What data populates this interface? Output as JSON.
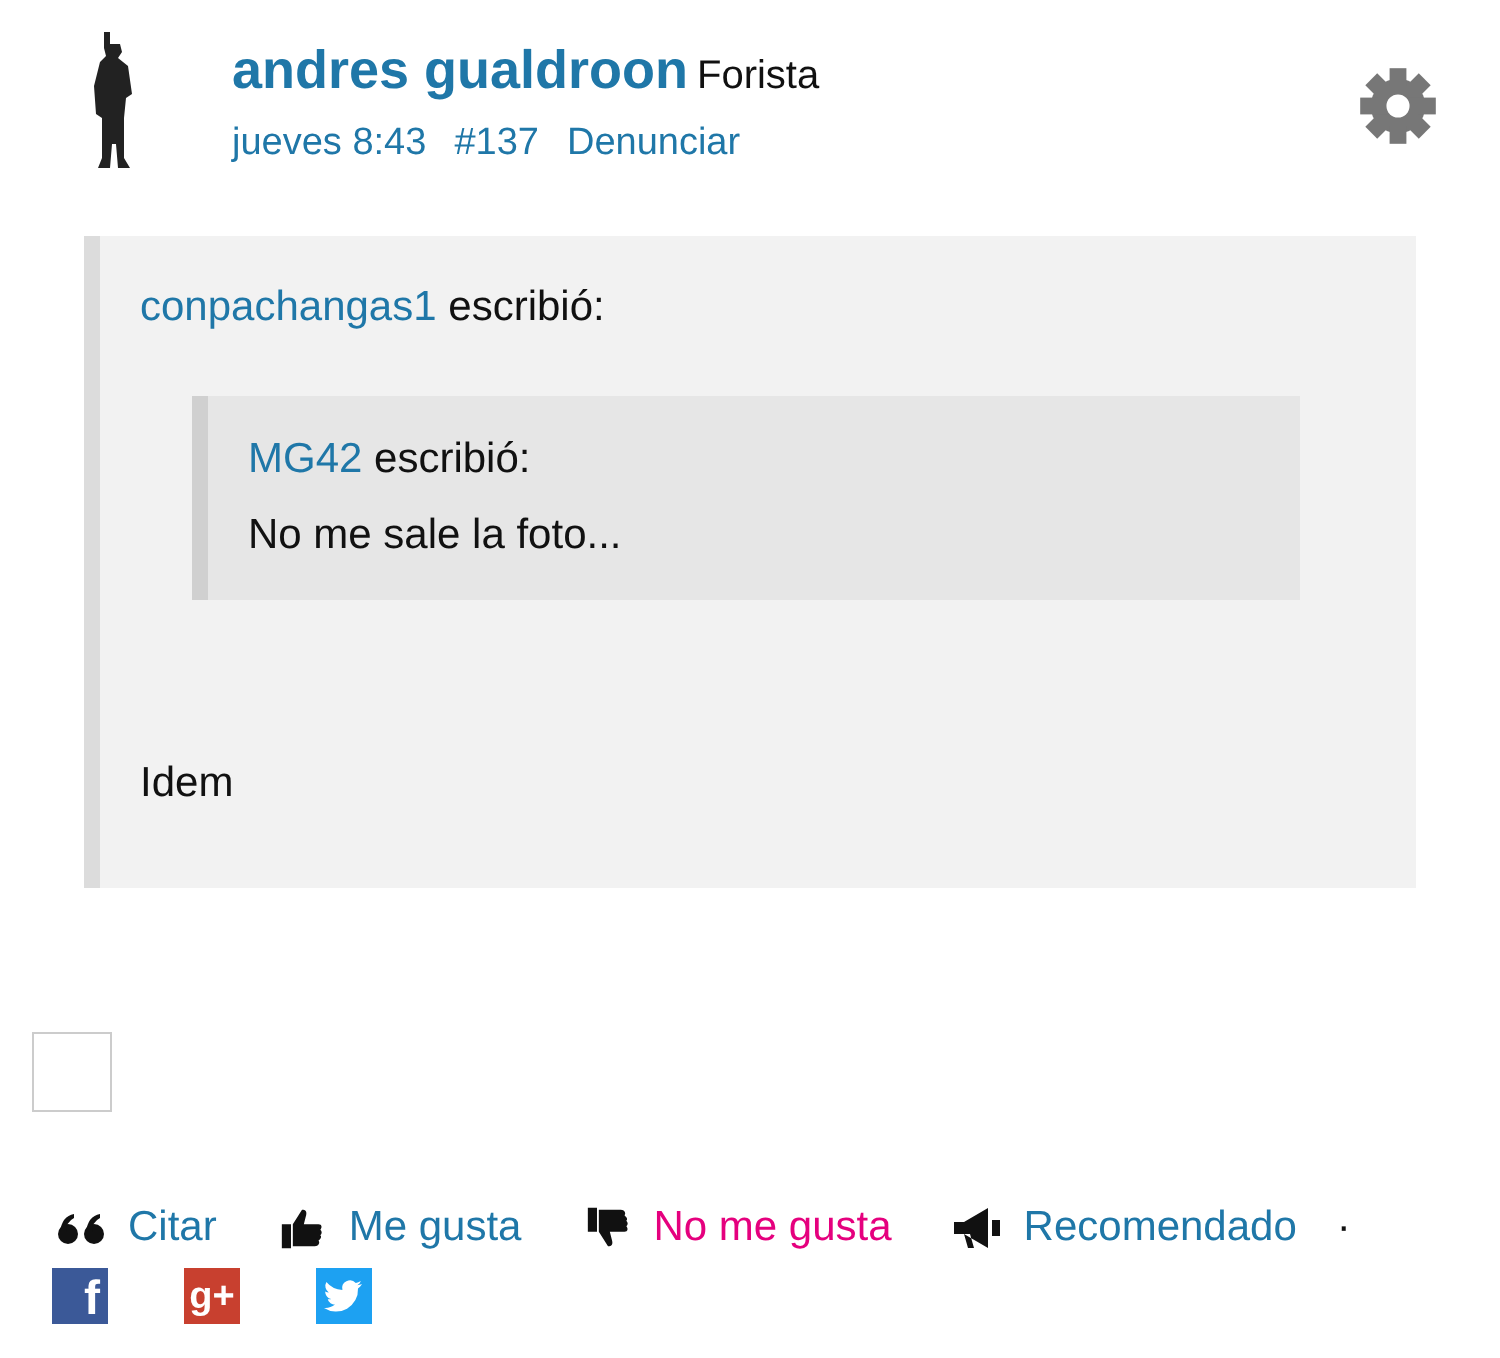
{
  "post": {
    "author": "andres gualdroon",
    "rank": "Forista",
    "time": "jueves 8:43",
    "number": "#137",
    "report": "Denunciar"
  },
  "quote": {
    "author": "conpachangas1",
    "verb": "escribió:",
    "nested": {
      "author": "MG42",
      "verb": "escribió:",
      "text": "No me sale la foto..."
    },
    "reply": "Idem"
  },
  "checkbox": {
    "checked": false
  },
  "actions": [
    {
      "kind": "quote",
      "label": "Citar",
      "color": "#1f77a8"
    },
    {
      "kind": "like",
      "label": "Me gusta",
      "color": "#1f77a8"
    },
    {
      "kind": "dislike",
      "label": "No me gusta",
      "color": "#e5007e"
    },
    {
      "kind": "recommend",
      "label": "Recomendado",
      "color": "#1f77a8"
    }
  ],
  "separator": "·",
  "share": [
    {
      "kind": "facebook",
      "label": "f"
    },
    {
      "kind": "googleplus",
      "label": "g+"
    },
    {
      "kind": "twitter"
    }
  ]
}
